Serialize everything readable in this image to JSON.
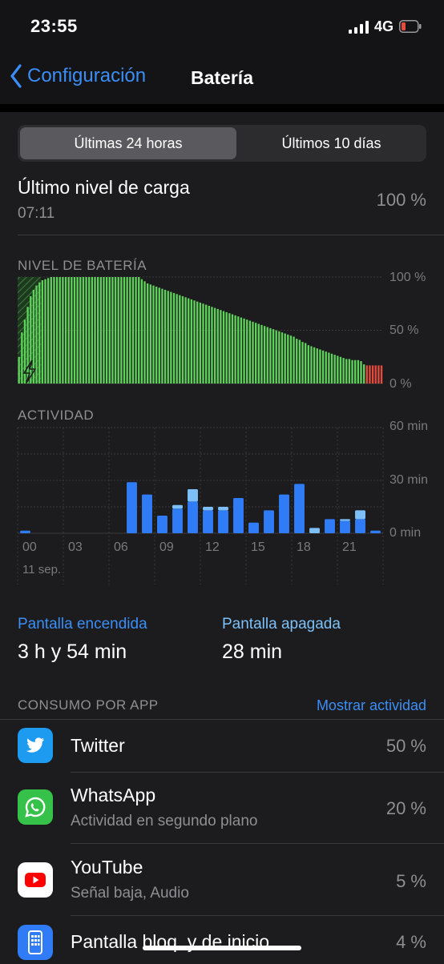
{
  "status": {
    "time": "23:55",
    "network": "4G"
  },
  "nav": {
    "back_label": "Configuración",
    "title": "Batería"
  },
  "segments": {
    "active": "Últimas 24 horas",
    "inactive": "Últimos 10 días"
  },
  "last_charge": {
    "label": "Último nivel de carga",
    "time": "07:11",
    "value": "100 %"
  },
  "battery_chart": {
    "label": "NIVEL DE BATERÍA",
    "ticks": [
      "100 %",
      "50 %",
      "0 %"
    ]
  },
  "activity_chart": {
    "label": "ACTIVIDAD",
    "ticks": [
      "60 min",
      "30 min",
      "0 min"
    ],
    "x_ticks": [
      "00",
      "03",
      "06",
      "09",
      "12",
      "15",
      "18",
      "21"
    ],
    "date": "11 sep."
  },
  "screen": {
    "on_label": "Pantalla encendida",
    "on_value": "3 h y 54 min",
    "off_label": "Pantalla apagada",
    "off_value": "28 min"
  },
  "usage": {
    "label": "CONSUMO POR APP",
    "show_activity": "Mostrar actividad",
    "apps": [
      {
        "name": "Twitter",
        "sub": "",
        "pct": "50 %"
      },
      {
        "name": "WhatsApp",
        "sub": "Actividad en segundo plano",
        "pct": "20 %"
      },
      {
        "name": "YouTube",
        "sub": "Señal baja, Audio",
        "pct": "5 %"
      },
      {
        "name": "Pantalla bloq. y de inicio",
        "sub": "",
        "pct": "4 %"
      }
    ]
  },
  "colors": {
    "accent": "#3a8ef6",
    "battery_green": "#5ed35a",
    "battery_red": "#e64b3c",
    "activity_dark": "#2f7cf6",
    "activity_light": "#7cc0f7"
  },
  "chart_data": [
    {
      "type": "bar",
      "title": "NIVEL DE BATERÍA",
      "ylim": [
        0,
        100
      ],
      "ytick_labels": [
        "0 %",
        "50 %",
        "100 %"
      ],
      "values": [
        25,
        48,
        60,
        72,
        82,
        88,
        92,
        95,
        97,
        98,
        99,
        100,
        100,
        100,
        100,
        100,
        100,
        100,
        100,
        100,
        100,
        100,
        100,
        100,
        100,
        100,
        100,
        100,
        100,
        100,
        100,
        100,
        100,
        100,
        100,
        100,
        100,
        100,
        100,
        100,
        100,
        100,
        98,
        96,
        94,
        93,
        92,
        91,
        90,
        89,
        88,
        87,
        86,
        85,
        84,
        83,
        82,
        81,
        80,
        79,
        78,
        77,
        76,
        75,
        74,
        73,
        72,
        71,
        70,
        69,
        68,
        67,
        66,
        65,
        64,
        63,
        62,
        61,
        60,
        59,
        58,
        57,
        56,
        55,
        54,
        53,
        52,
        51,
        50,
        49,
        48,
        47,
        46,
        45,
        44,
        42,
        41,
        39,
        38,
        36,
        35,
        34,
        33,
        32,
        31,
        30,
        29,
        28,
        27,
        26,
        25,
        24,
        23,
        23,
        22,
        22,
        22,
        21,
        18,
        17,
        17,
        17,
        17,
        17,
        17
      ],
      "low_from_index": 119,
      "charging_until_index": 8
    },
    {
      "type": "bar",
      "title": "ACTIVIDAD",
      "ylim": [
        0,
        60
      ],
      "ytick_labels": [
        "0 min",
        "30 min",
        "60 min"
      ],
      "categories": [
        "00",
        "01",
        "02",
        "03",
        "04",
        "05",
        "06",
        "07",
        "08",
        "09",
        "10",
        "11",
        "12",
        "13",
        "14",
        "15",
        "16",
        "17",
        "18",
        "19",
        "20",
        "21",
        "22",
        "23"
      ],
      "series": [
        {
          "name": "",
          "values": [
            1.5,
            0,
            0,
            0,
            0,
            0,
            0,
            29,
            22,
            10,
            14,
            18,
            13,
            13,
            20,
            6,
            13,
            22,
            28,
            0,
            8,
            7,
            8,
            1.5
          ]
        },
        {
          "name": "",
          "values": [
            0,
            0,
            0,
            0,
            0,
            0,
            0,
            0,
            0,
            0,
            2,
            7,
            2,
            2,
            0,
            0,
            0,
            0,
            0,
            3,
            0,
            1,
            5,
            0
          ]
        }
      ],
      "xlabel": "11 sep."
    }
  ]
}
